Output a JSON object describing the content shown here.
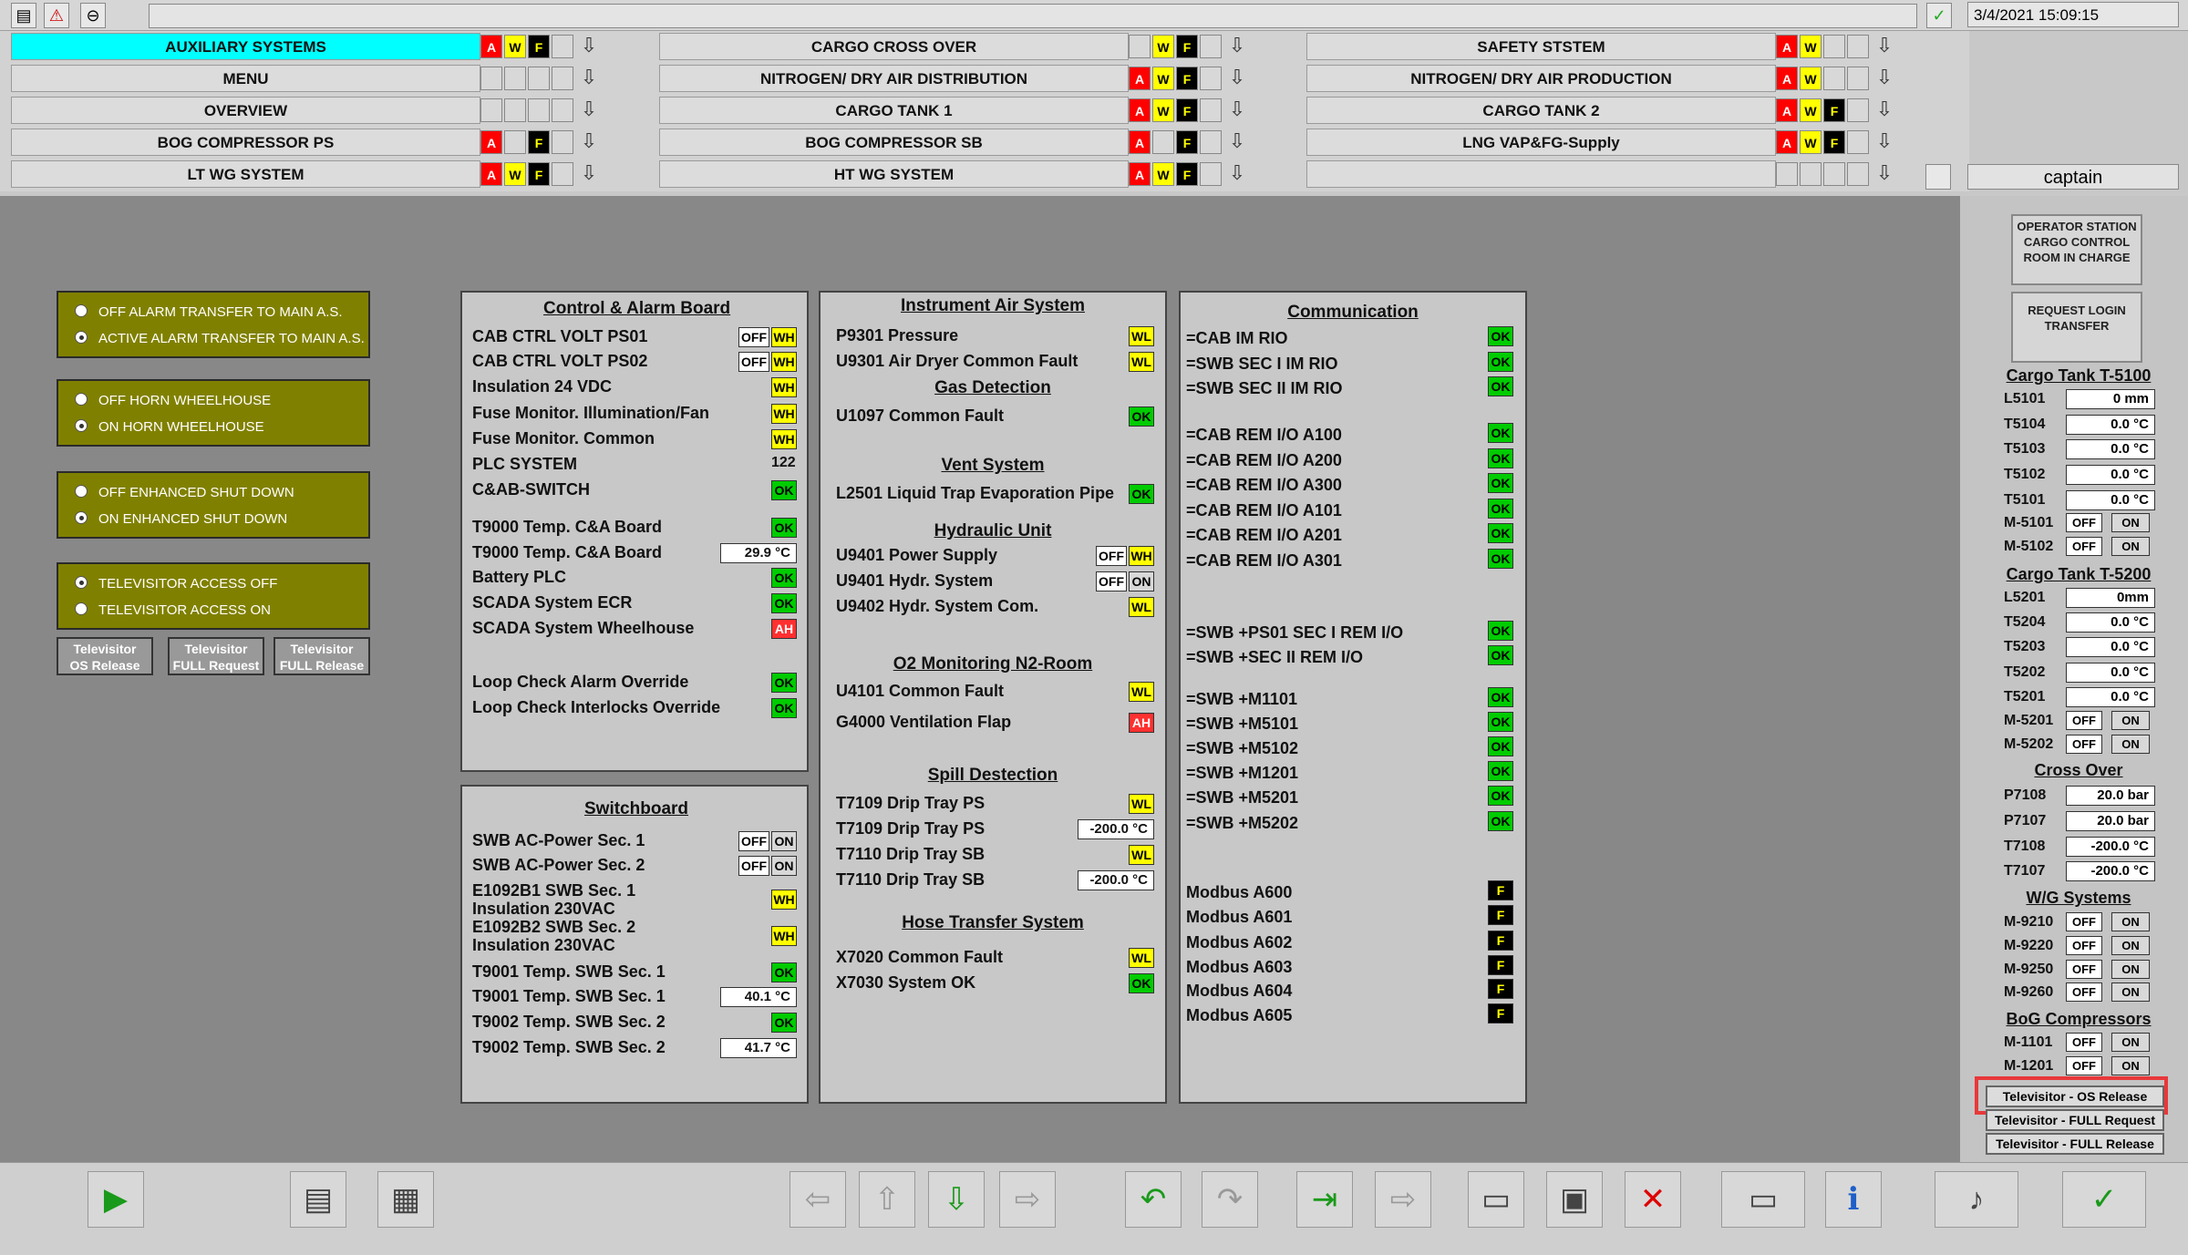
{
  "datetime": "3/4/2021 15:09:15",
  "user": "captain",
  "nav": [
    {
      "label": "AUXILIARY SYSTEMS",
      "flags": [
        "A",
        "W",
        "F"
      ]
    },
    {
      "label": "CARGO CROSS OVER",
      "flags": [
        "",
        "W",
        "F"
      ]
    },
    {
      "label": "SAFETY STSTEM",
      "flags": [
        "A",
        "W",
        ""
      ]
    },
    {
      "label": "MENU",
      "flags": [
        "",
        "",
        ""
      ]
    },
    {
      "label": "NITROGEN/ DRY AIR DISTRIBUTION",
      "flags": [
        "A",
        "W",
        "F"
      ]
    },
    {
      "label": "NITROGEN/ DRY AIR PRODUCTION",
      "flags": [
        "A",
        "W",
        ""
      ]
    },
    {
      "label": "OVERVIEW",
      "flags": [
        "",
        "",
        ""
      ]
    },
    {
      "label": "CARGO TANK 1",
      "flags": [
        "A",
        "W",
        "F"
      ]
    },
    {
      "label": "CARGO TANK 2",
      "flags": [
        "A",
        "W",
        "F"
      ]
    },
    {
      "label": "BOG COMPRESSOR PS",
      "flags": [
        "A",
        "",
        "F"
      ]
    },
    {
      "label": "BOG COMPRESSOR SB",
      "flags": [
        "A",
        "",
        "F"
      ]
    },
    {
      "label": "LNG VAP&FG-Supply",
      "flags": [
        "A",
        "W",
        "F"
      ]
    },
    {
      "label": "LT WG SYSTEM",
      "flags": [
        "A",
        "W",
        "F"
      ]
    },
    {
      "label": "HT WG SYSTEM",
      "flags": [
        "A",
        "W",
        "F"
      ]
    },
    {
      "label": "",
      "flags": [
        "",
        "",
        ""
      ]
    }
  ],
  "options": [
    [
      "OFF ALARM TRANSFER TO MAIN A.S.",
      "ACTIVE  ALARM TRANSFER TO MAIN A.S."
    ],
    [
      "OFF HORN WHEELHOUSE",
      "ON HORN WHEELHOUSE"
    ],
    [
      "OFF ENHANCED SHUT DOWN",
      "ON   ENHANCED SHUT DOWN"
    ],
    [
      "TELEVISITOR ACCESS OFF",
      "TELEVISITOR ACCESS ON"
    ]
  ],
  "tv_buttons": [
    [
      "Televisitor",
      "OS Release"
    ],
    [
      "Televisitor",
      "FULL Request"
    ],
    [
      "Televisitor",
      "FULL Release"
    ]
  ],
  "cab": {
    "title": "Control & Alarm Board",
    "rows": [
      {
        "l": "CAB CTRL VOLT PS01",
        "tags": [
          "OFF",
          "WH"
        ]
      },
      {
        "l": "CAB CTRL VOLT PS02",
        "tags": [
          "OFF",
          "WH"
        ]
      },
      {
        "l": "Insulation 24 VDC",
        "tags": [
          "WH"
        ]
      },
      {
        "l": "Fuse Monitor. Illumination/Fan",
        "tags": [
          "WH"
        ]
      },
      {
        "l": "Fuse Monitor. Common",
        "tags": [
          "WH"
        ]
      },
      {
        "l": "PLC SYSTEM",
        "text": "122"
      },
      {
        "l": "C&AB-SWITCH",
        "tags": [
          "OK"
        ]
      },
      {
        "l": "T9000 Temp. C&A Board",
        "tags": [
          "OK"
        ]
      },
      {
        "l": "T9000 Temp. C&A Board",
        "v": "29.9",
        "u": "°C"
      },
      {
        "l": "Battery PLC",
        "tags": [
          "OK"
        ]
      },
      {
        "l": "SCADA System ECR",
        "tags": [
          "OK"
        ]
      },
      {
        "l": "SCADA System Wheelhouse",
        "tags": [
          "AH"
        ]
      },
      {
        "l": "Loop Check Alarm Override",
        "tags": [
          "OK"
        ]
      },
      {
        "l": "Loop Check Interlocks Override",
        "tags": [
          "OK"
        ]
      }
    ]
  },
  "swb": {
    "title": "Switchboard",
    "rows": [
      {
        "l": "SWB AC-Power Sec. 1",
        "tags": [
          "OFF",
          "ON"
        ]
      },
      {
        "l": "SWB AC-Power Sec. 2",
        "tags": [
          "OFF",
          "ON"
        ]
      },
      {
        "l": "E1092B1 SWB Sec. 1",
        "l2": "Insulation 230VAC",
        "tags": [
          "WH"
        ]
      },
      {
        "l": "E1092B2 SWB Sec. 2",
        "l2": "Insulation 230VAC",
        "tags": [
          "WH"
        ]
      },
      {
        "l": "T9001 Temp. SWB Sec. 1",
        "tags": [
          "OK"
        ]
      },
      {
        "l": "T9001 Temp. SWB Sec. 1",
        "v": "40.1",
        "u": "°C"
      },
      {
        "l": "T9002 Temp. SWB Sec. 2",
        "tags": [
          "OK"
        ]
      },
      {
        "l": "T9002 Temp. SWB Sec. 2",
        "v": "41.7",
        "u": "°C"
      }
    ]
  },
  "mid": {
    "sections": [
      {
        "t": "Instrument Air System",
        "rows": [
          {
            "l": "P9301 Pressure",
            "tags": [
              "WL"
            ]
          },
          {
            "l": "U9301 Air Dryer Common Fault",
            "tags": [
              "WL"
            ]
          }
        ]
      },
      {
        "t": "Gas Detection",
        "rows": [
          {
            "l": "U1097 Common Fault",
            "tags": [
              "OK"
            ]
          }
        ]
      },
      {
        "t": "Vent System",
        "rows": [
          {
            "l": "L2501 Liquid Trap Evaporation Pipe",
            "tags": [
              "OK"
            ]
          }
        ]
      },
      {
        "t": "Hydraulic Unit",
        "rows": [
          {
            "l": "U9401 Power Supply",
            "tags": [
              "OFF",
              "WH"
            ]
          },
          {
            "l": "U9401 Hydr. System",
            "tags": [
              "OFF",
              "ON"
            ]
          },
          {
            "l": "U9402 Hydr. System Com.",
            "tags": [
              "WL"
            ]
          }
        ]
      },
      {
        "t": "O2 Monitoring N2-Room",
        "rows": [
          {
            "l": "U4101 Common Fault",
            "tags": [
              "WL"
            ]
          },
          {
            "l": "G4000 Ventilation Flap",
            "tags": [
              "AH"
            ]
          }
        ]
      },
      {
        "t": "Spill Destection",
        "rows": [
          {
            "l": "T7109 Drip Tray PS",
            "tags": [
              "WL"
            ]
          },
          {
            "l": "T7109 Drip Tray PS",
            "v": "-200.0",
            "u": "°C"
          },
          {
            "l": "T7110 Drip Tray SB",
            "tags": [
              "WL"
            ]
          },
          {
            "l": "T7110 Drip Tray SB",
            "v": "-200.0",
            "u": "°C"
          }
        ]
      },
      {
        "t": "Hose Transfer System",
        "rows": [
          {
            "l": "X7020 Common Fault",
            "tags": [
              "WL"
            ]
          },
          {
            "l": "X7030 System OK",
            "tags": [
              "OK"
            ]
          }
        ]
      }
    ]
  },
  "comm": {
    "title": "Communication",
    "rows": [
      {
        "l": "=CAB IM RIO",
        "tags": [
          "OK"
        ]
      },
      {
        "l": "=SWB SEC I IM RIO",
        "tags": [
          "OK"
        ]
      },
      {
        "l": "=SWB SEC II IM RIO",
        "tags": [
          "OK"
        ]
      },
      {
        "l": "=CAB REM I/O A100",
        "tags": [
          "OK"
        ]
      },
      {
        "l": "=CAB REM I/O A200",
        "tags": [
          "OK"
        ]
      },
      {
        "l": "=CAB REM I/O A300",
        "tags": [
          "OK"
        ]
      },
      {
        "l": "=CAB REM I/O A101",
        "tags": [
          "OK"
        ]
      },
      {
        "l": "=CAB REM I/O A201",
        "tags": [
          "OK"
        ]
      },
      {
        "l": "=CAB REM I/O A301",
        "tags": [
          "OK"
        ]
      },
      {
        "l": "=SWB +PS01 SEC I REM I/O",
        "tags": [
          "OK"
        ]
      },
      {
        "l": "=SWB +SEC II REM I/O",
        "tags": [
          "OK"
        ]
      },
      {
        "l": "=SWB +M1101",
        "tags": [
          "OK"
        ]
      },
      {
        "l": "=SWB +M5101",
        "tags": [
          "OK"
        ]
      },
      {
        "l": "=SWB +M5102",
        "tags": [
          "OK"
        ]
      },
      {
        "l": "=SWB +M1201",
        "tags": [
          "OK"
        ]
      },
      {
        "l": "=SWB +M5201",
        "tags": [
          "OK"
        ]
      },
      {
        "l": "=SWB +M5202",
        "tags": [
          "OK"
        ]
      },
      {
        "l": "Modbus A600",
        "tags": [
          "F"
        ]
      },
      {
        "l": "Modbus A601",
        "tags": [
          "F"
        ]
      },
      {
        "l": "Modbus A602",
        "tags": [
          "F"
        ]
      },
      {
        "l": "Modbus A603",
        "tags": [
          "F"
        ]
      },
      {
        "l": "Modbus A604",
        "tags": [
          "F"
        ]
      },
      {
        "l": "Modbus A605",
        "tags": [
          "F"
        ]
      }
    ]
  },
  "right": {
    "station": "OPERATOR STATION CARGO CONTROL ROOM IN CHARGE",
    "request": "REQUEST LOGIN TRANSFER",
    "t5100": {
      "title": "Cargo Tank T-5100",
      "rows": [
        {
          "l": "L5101",
          "v": "0 mm"
        },
        {
          "l": "T5104",
          "v": "0.0 °C"
        },
        {
          "l": "T5103",
          "v": "0.0 °C"
        },
        {
          "l": "T5102",
          "v": "0.0 °C"
        },
        {
          "l": "T5101",
          "v": "0.0 °C"
        },
        {
          "l": "M-5101",
          "s": true
        },
        {
          "l": "M-5102",
          "s": true
        }
      ]
    },
    "t5200": {
      "title": "Cargo Tank T-5200",
      "rows": [
        {
          "l": "L5201",
          "v": "0mm"
        },
        {
          "l": "T5204",
          "v": "0.0 °C"
        },
        {
          "l": "T5203",
          "v": "0.0 °C"
        },
        {
          "l": "T5202",
          "v": "0.0 °C"
        },
        {
          "l": "T5201",
          "v": "0.0 °C"
        },
        {
          "l": "M-5201",
          "s": true
        },
        {
          "l": "M-5202",
          "s": true
        }
      ]
    },
    "cross": {
      "title": "Cross Over",
      "rows": [
        {
          "l": "P7108",
          "v": "20.0  bar"
        },
        {
          "l": "P7107",
          "v": "20.0  bar"
        },
        {
          "l": "T7108",
          "v": "-200.0 °C"
        },
        {
          "l": "T7107",
          "v": "-200.0 °C"
        }
      ]
    },
    "wg": {
      "title": "W/G Systems",
      "rows": [
        {
          "l": "M-9210",
          "s": true
        },
        {
          "l": "M-9220",
          "s": true
        },
        {
          "l": "M-9250",
          "s": true
        },
        {
          "l": "M-9260",
          "s": true
        }
      ]
    },
    "bog": {
      "title": "BoG Compressors",
      "rows": [
        {
          "l": "M-1101",
          "s": true
        },
        {
          "l": "M-1201",
          "s": true
        }
      ]
    },
    "off": "OFF",
    "on": "ON",
    "tv": [
      "Televisitor - OS Release",
      "Televisitor - FULL Request",
      "Televisitor - FULL Release"
    ]
  },
  "bottom_icons": [
    "play-icon",
    "new-page-icon",
    "page-list-icon",
    "arrow-left-icon",
    "arrow-up-icon",
    "arrow-down-icon",
    "arrow-right-icon",
    "undo-icon",
    "redo-icon",
    "import-icon",
    "export-icon",
    "open-file-icon",
    "save-file-icon",
    "delete-file-icon",
    "monitor-view-icon",
    "info-icon",
    "sound-acknowledge-icon",
    "acknowledge-all-icon"
  ]
}
